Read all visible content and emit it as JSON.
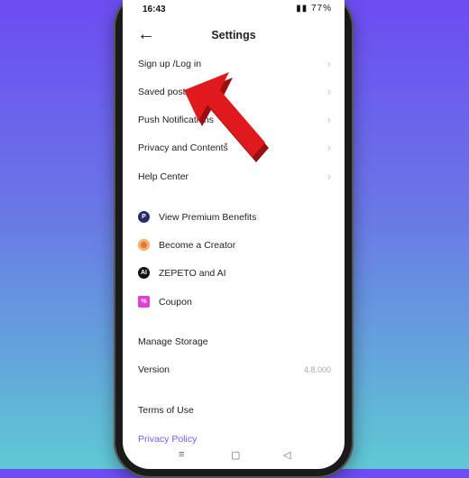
{
  "status": {
    "time": "16:43",
    "battery": "77%"
  },
  "header": {
    "back_icon": "arrow-left-icon",
    "title": "Settings"
  },
  "menu": {
    "group1": [
      {
        "label": "Sign up /Log in"
      },
      {
        "label": "Saved posts"
      },
      {
        "label": "Push Notifications"
      },
      {
        "label": "Privacy and Contents"
      },
      {
        "label": "Help Center"
      }
    ],
    "group2": [
      {
        "label": "View Premium Benefits",
        "icon": "premium-icon",
        "icon_text": "P",
        "color": "#2a2a6e"
      },
      {
        "label": "Become a Creator",
        "icon": "creator-icon",
        "icon_text": "",
        "color": "#e8772a"
      },
      {
        "label": "ZEPETO and AI",
        "icon": "ai-icon",
        "icon_text": "AI",
        "color": "#111111"
      },
      {
        "label": "Coupon",
        "icon": "coupon-icon",
        "icon_text": "%",
        "color": "#e040d8"
      }
    ],
    "group3": [
      {
        "label": "Manage Storage"
      },
      {
        "label": "Version",
        "value": "4.8.000"
      }
    ],
    "group4": [
      {
        "label": "Terms of Use"
      },
      {
        "label": "Privacy Policy"
      }
    ]
  },
  "colors": {
    "arrow": "#e0191c",
    "accent": "#7a5cff"
  }
}
